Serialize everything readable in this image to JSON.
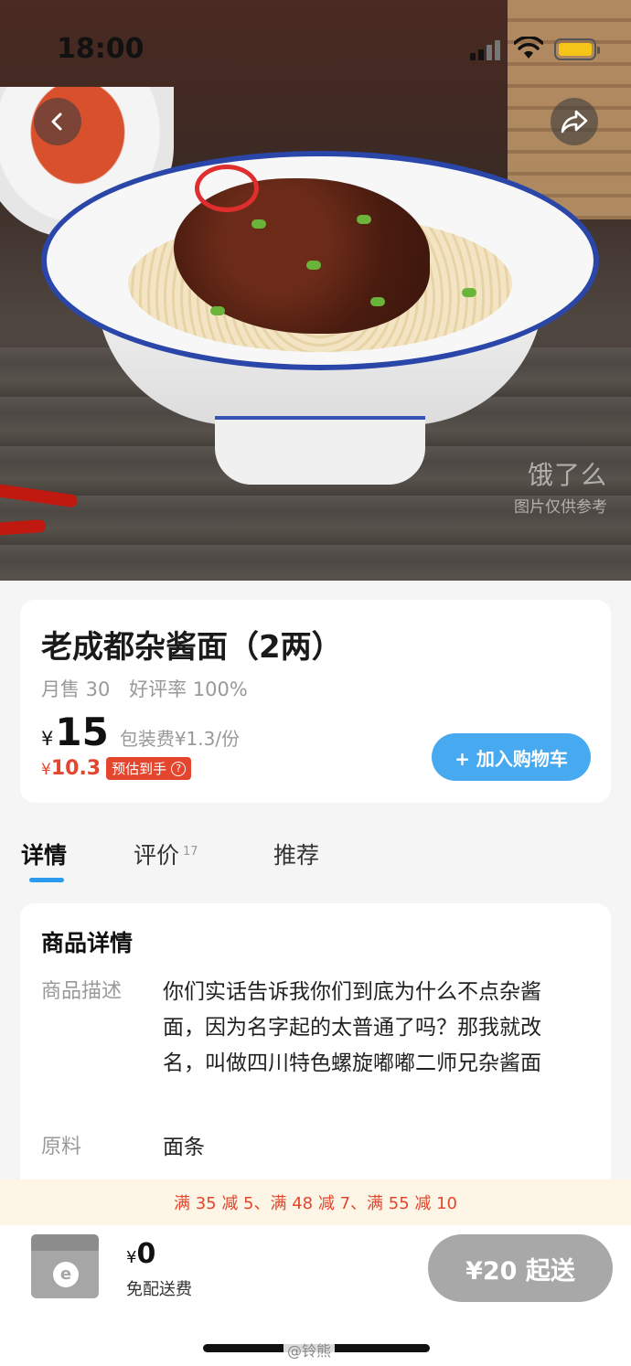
{
  "status_bar": {
    "time": "18:00"
  },
  "hero": {
    "watermark_logo": "饿了么",
    "watermark_caption": "图片仅供参考"
  },
  "nav": {
    "back_icon": "chevron-left-icon",
    "share_icon": "share-arrow-icon"
  },
  "product": {
    "name": "老成都杂酱面（2两）",
    "monthly_sales": "月售 30",
    "good_rate": "好评率 100%",
    "currency": "¥",
    "price": "15",
    "packaging_fee": "包装费¥1.3/份",
    "estimated_currency": "¥",
    "estimated_price": "10.3",
    "estimated_label": "预估到手",
    "add_to_cart": "+ 加入购物车"
  },
  "tabs": [
    {
      "label": "详情",
      "active": true
    },
    {
      "label": "评价",
      "count": "17"
    },
    {
      "label": "推荐"
    }
  ],
  "details": {
    "title": "商品详情",
    "rows": [
      {
        "label": "商品描述",
        "value": "你们实话告诉我你们到底为什么不点杂酱面，因为名字起的太普通了吗？那我就改名，叫做四川特色螺旋嘟嘟二师兄杂酱面"
      },
      {
        "label": "原料",
        "value": "面条"
      }
    ]
  },
  "promo": {
    "text": "满 35 减 5、满 48 减 7、满 55 减 10"
  },
  "cart": {
    "currency": "¥",
    "amount": "0",
    "delivery": "免配送费",
    "checkout": "¥20 起送"
  },
  "watermark_bottom": "@铃熊",
  "colors": {
    "accent_blue": "#47aaf0",
    "price_red": "#e4452d",
    "promo_bg": "#fdf5e6",
    "checkout_disabled": "#a8a8a8"
  }
}
